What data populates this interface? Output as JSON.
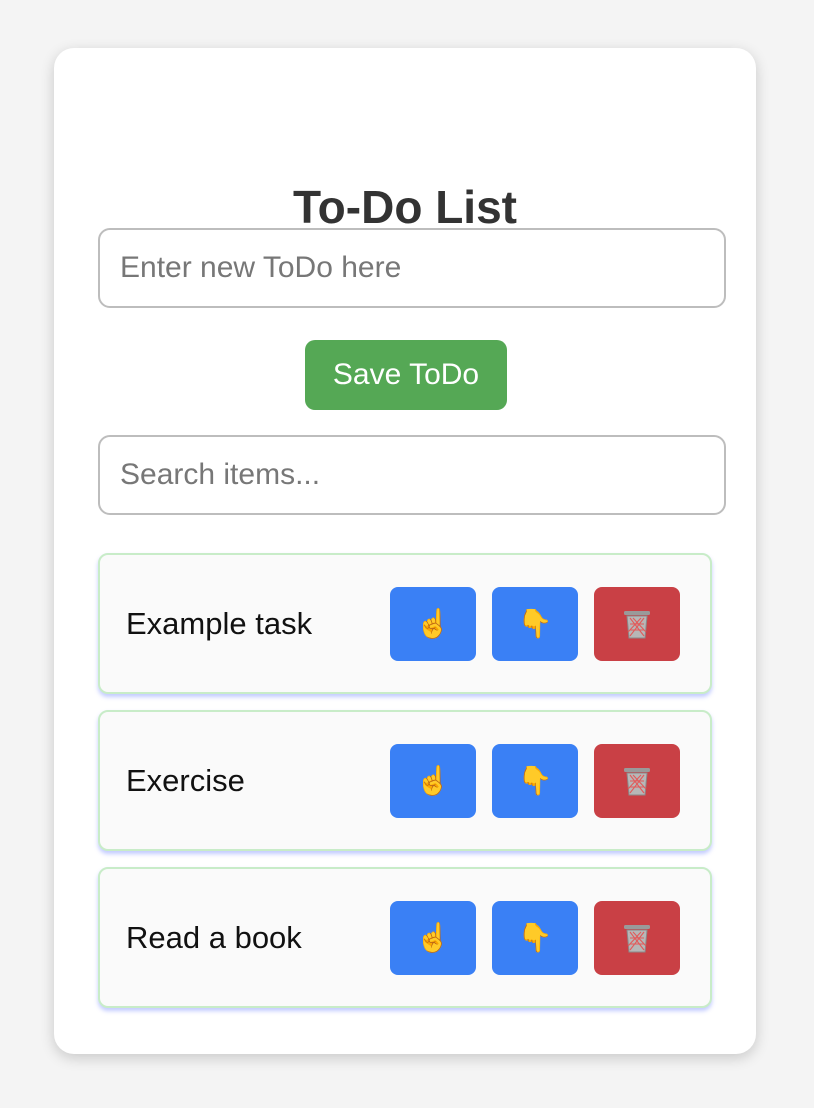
{
  "header": {
    "title": "To-Do List"
  },
  "new_todo": {
    "placeholder": "Enter new ToDo here",
    "value": ""
  },
  "save_button": {
    "label": "Save ToDo"
  },
  "search": {
    "placeholder": "Search items...",
    "value": ""
  },
  "colors": {
    "save_button": "#55a855",
    "move_button": "#3a80f5",
    "delete_button": "#c94045",
    "item_border": "#c8ecc8"
  },
  "icons": {
    "move_up": "pointing-up-icon",
    "move_down": "pointing-down-icon",
    "delete": "trash-can-icon"
  },
  "items": [
    {
      "text": "Example task"
    },
    {
      "text": "Exercise"
    },
    {
      "text": "Read a book"
    }
  ]
}
